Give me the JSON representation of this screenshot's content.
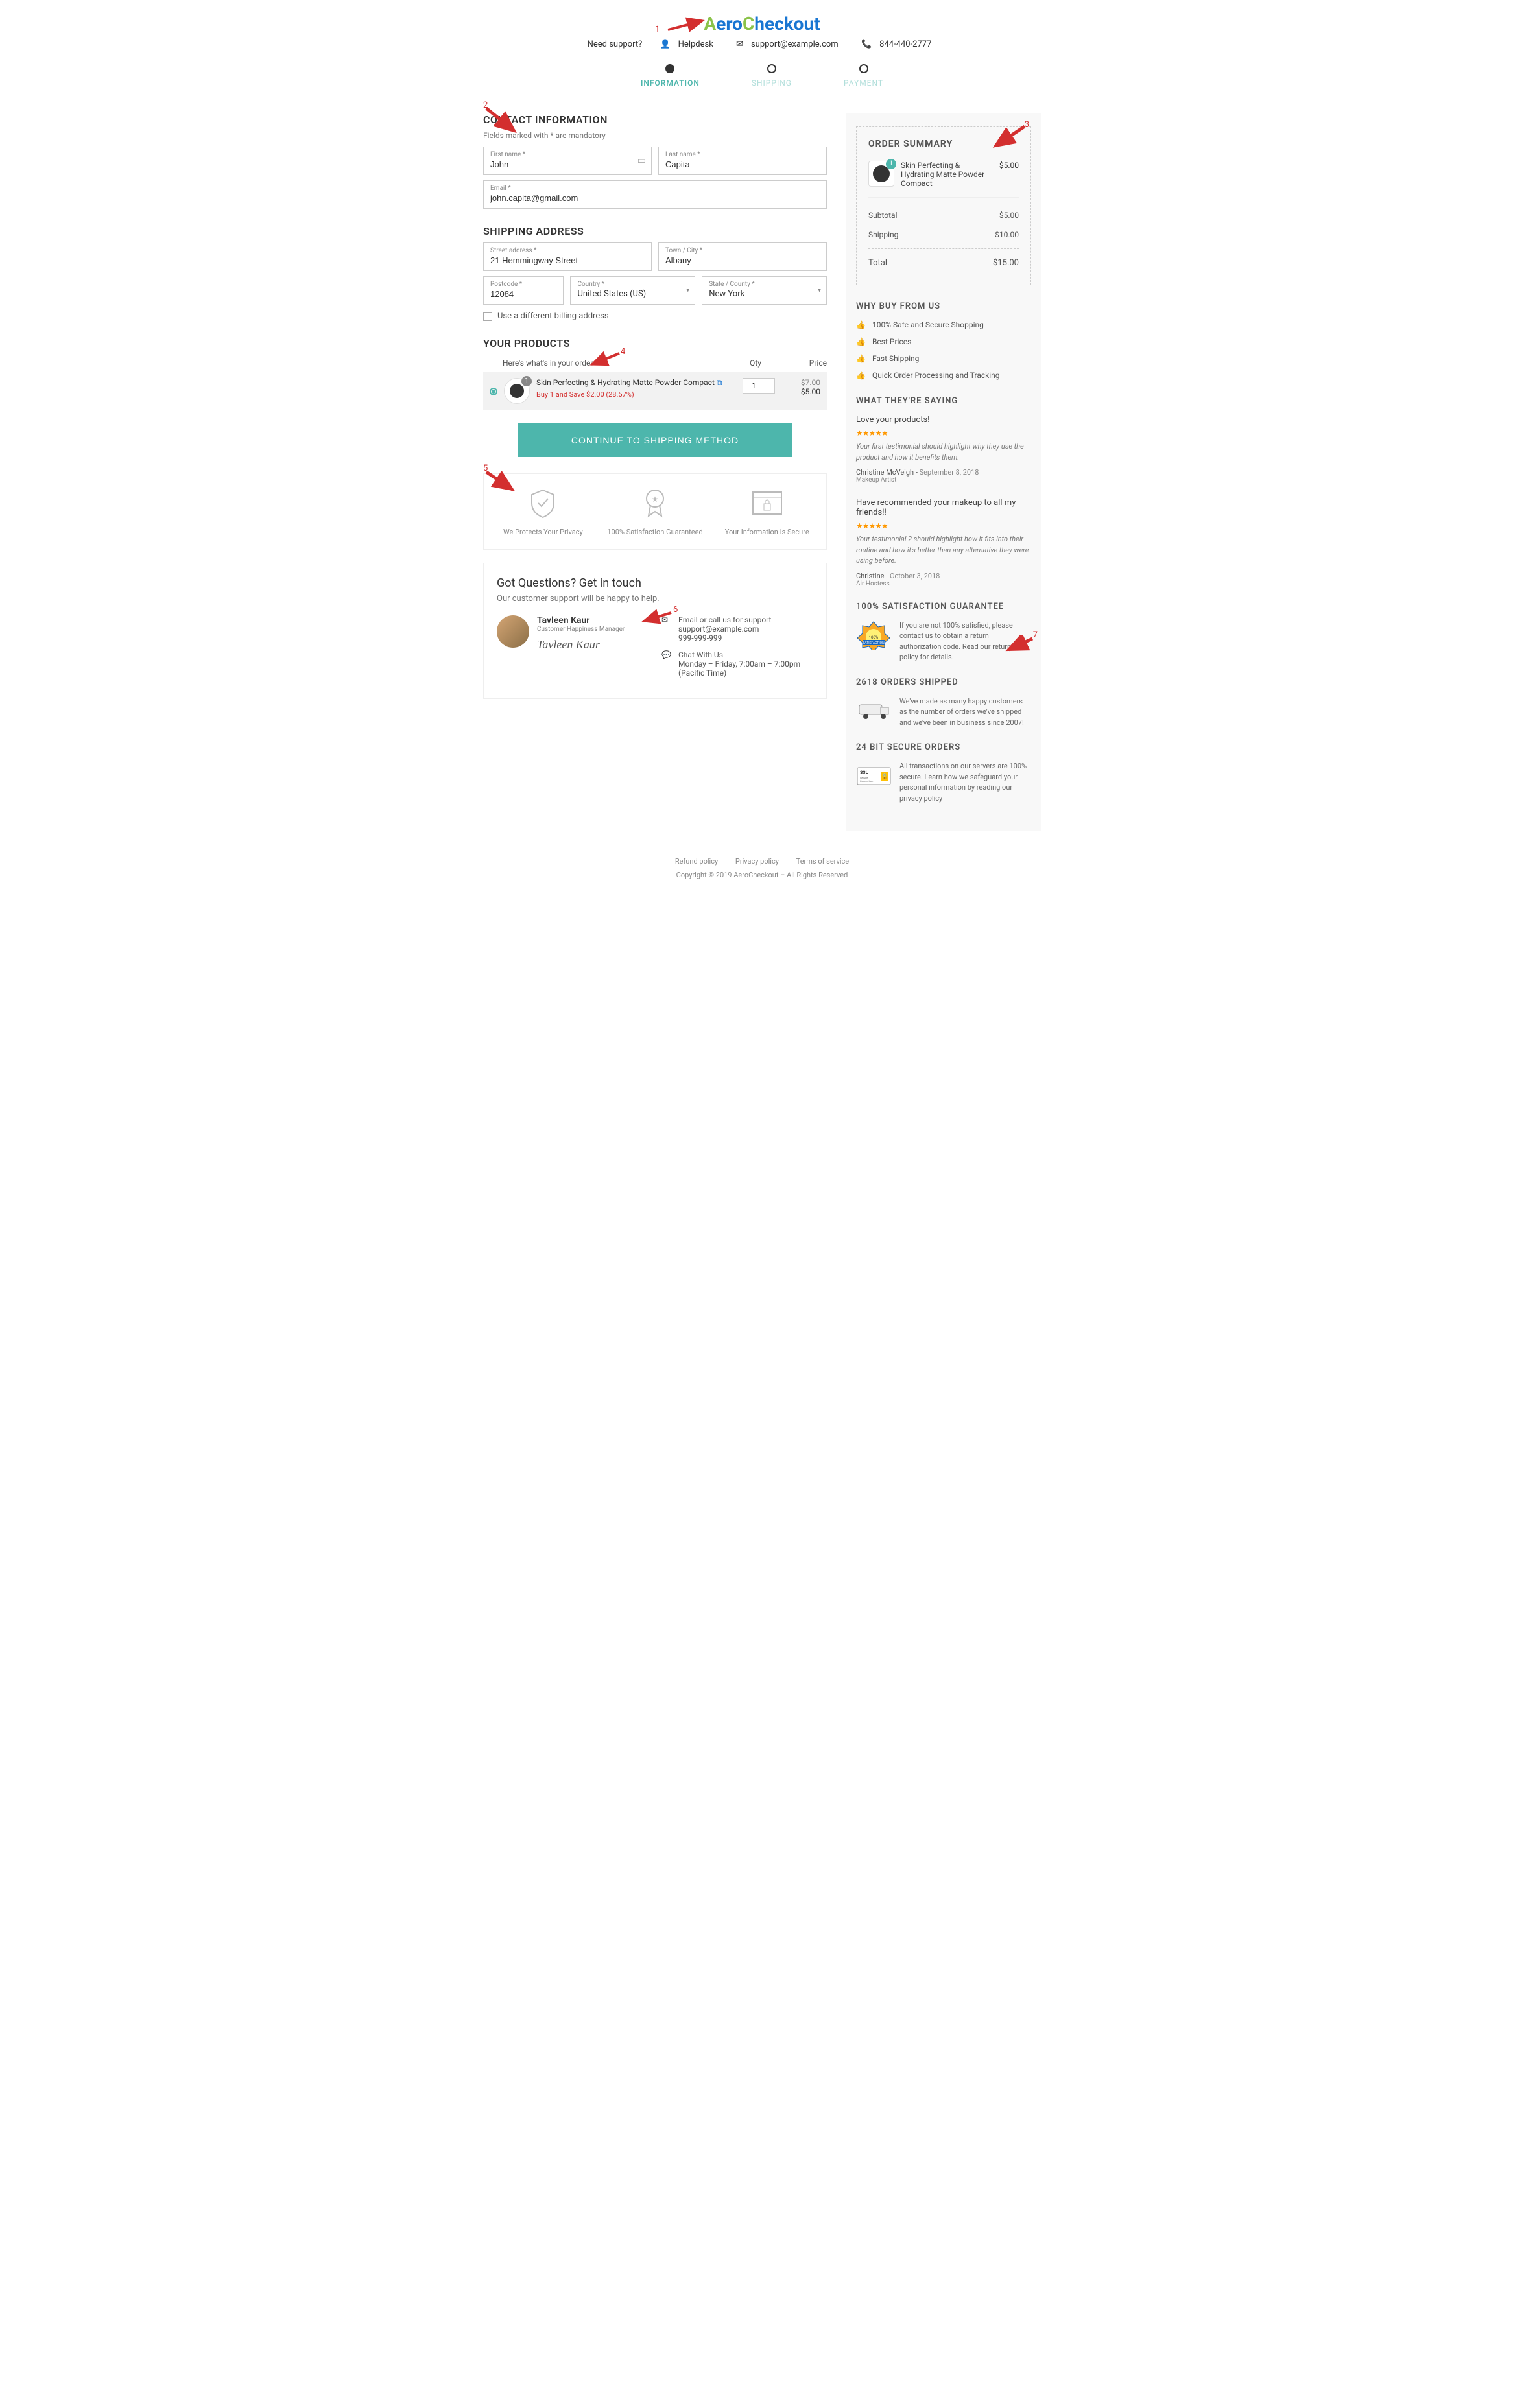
{
  "header": {
    "logo_parts": {
      "a": "A",
      "ero": "ero",
      "c": "C",
      "heckout": "heckout"
    },
    "support_label": "Need support?",
    "helpdesk": "Helpdesk",
    "email": "support@example.com",
    "phone": "844-440-2777"
  },
  "steps": [
    {
      "label": "INFORMATION",
      "state": "active"
    },
    {
      "label": "SHIPPING",
      "state": "inactive"
    },
    {
      "label": "PAYMENT",
      "state": "inactive"
    }
  ],
  "contact": {
    "title": "CONTACT INFORMATION",
    "hint": "Fields marked with * are mandatory",
    "first_name_label": "First name *",
    "first_name": "John",
    "last_name_label": "Last name *",
    "last_name": "Capita",
    "email_label": "Email *",
    "email": "john.capita@gmail.com"
  },
  "shipping": {
    "title": "SHIPPING ADDRESS",
    "street_label": "Street address *",
    "street": "21 Hemmingway Street",
    "city_label": "Town / City *",
    "city": "Albany",
    "postcode_label": "Postcode *",
    "postcode": "12084",
    "country_label": "Country *",
    "country": "United States (US)",
    "state_label": "State / County *",
    "state": "New York",
    "diff_billing": "Use a different billing address"
  },
  "products": {
    "title": "YOUR PRODUCTS",
    "hint": "Here's what's in your order",
    "col_qty": "Qty",
    "col_price": "Price",
    "item": {
      "name": "Skin Perfecting & Hydrating Matte Powder Compact",
      "badge": "1",
      "promo": "Buy 1 and Save $2.00 (28.57%)",
      "qty": "1",
      "price_old": "$7.00",
      "price_new": "$5.00"
    },
    "cta": "CONTINUE TO SHIPPING METHOD"
  },
  "trust": [
    {
      "text": "We Protects Your Privacy"
    },
    {
      "text": "100% Satisfaction Guaranteed"
    },
    {
      "text": "Your Information Is Secure"
    }
  ],
  "contact_box": {
    "title": "Got Questions? Get in touch",
    "sub": "Our customer support will be happy to help.",
    "person": {
      "name": "Tavleen Kaur",
      "role": "Customer Happiness Manager",
      "signature": "Tavleen Kaur"
    },
    "method1": {
      "title": "Email or call us for support",
      "email": "support@example.com",
      "phone": "999-999-999"
    },
    "method2": {
      "title": "Chat With Us",
      "hours": "Monday – Friday, 7:00am – 7:00pm (Pacific Time)"
    }
  },
  "summary": {
    "title": "ORDER SUMMARY",
    "item": {
      "badge": "1",
      "name": "Skin Perfecting & Hydrating Matte Powder Compact",
      "price": "$5.00"
    },
    "subtotal_label": "Subtotal",
    "subtotal": "$5.00",
    "shipping_label": "Shipping",
    "shipping": "$10.00",
    "total_label": "Total",
    "total": "$15.00"
  },
  "why_buy": {
    "title": "WHY BUY FROM US",
    "items": [
      "100% Safe and Secure Shopping",
      "Best Prices",
      "Fast Shipping",
      "Quick Order Processing and Tracking"
    ]
  },
  "testimonials": {
    "title": "WHAT THEY'RE SAYING",
    "items": [
      {
        "title": "Love your products!",
        "body": "Your first testimonial should highlight why they use the product and how it benefits them.",
        "author": "Christine McVeigh",
        "date": "September 8, 2018",
        "role": "Makeup Artist"
      },
      {
        "title": "Have recommended your makeup to all my friends!!",
        "body": "Your testimonial 2 should highlight how it fits into their routine and how it's better than any alternative they were using before.",
        "author": "Christine",
        "date": "October 3, 2018",
        "role": "Air Hostess"
      }
    ]
  },
  "guarantees": [
    {
      "title": "100% SATISFACTION GUARANTEE",
      "text": "If you are not 100% satisfied, please contact us to obtain a return authorization code. Read our return policy for details.",
      "badge": "satisfaction"
    },
    {
      "title": "2618 ORDERS SHIPPED",
      "text": "We've made as many happy customers as the number of orders we've shipped and we've been in business since 2007!",
      "badge": "van"
    },
    {
      "title": "24 BIT SECURE ORDERS",
      "text": "All transactions on our servers are 100% secure. Learn how we safeguard your personal information by reading our privacy policy",
      "badge": "ssl"
    }
  ],
  "footer": {
    "links": [
      "Refund policy",
      "Privacy policy",
      "Terms of service"
    ],
    "copy": "Copyright © 2019 AeroCheckout – All Rights Reserved"
  },
  "annotations": [
    "1",
    "2",
    "3",
    "4",
    "5",
    "6",
    "7"
  ]
}
